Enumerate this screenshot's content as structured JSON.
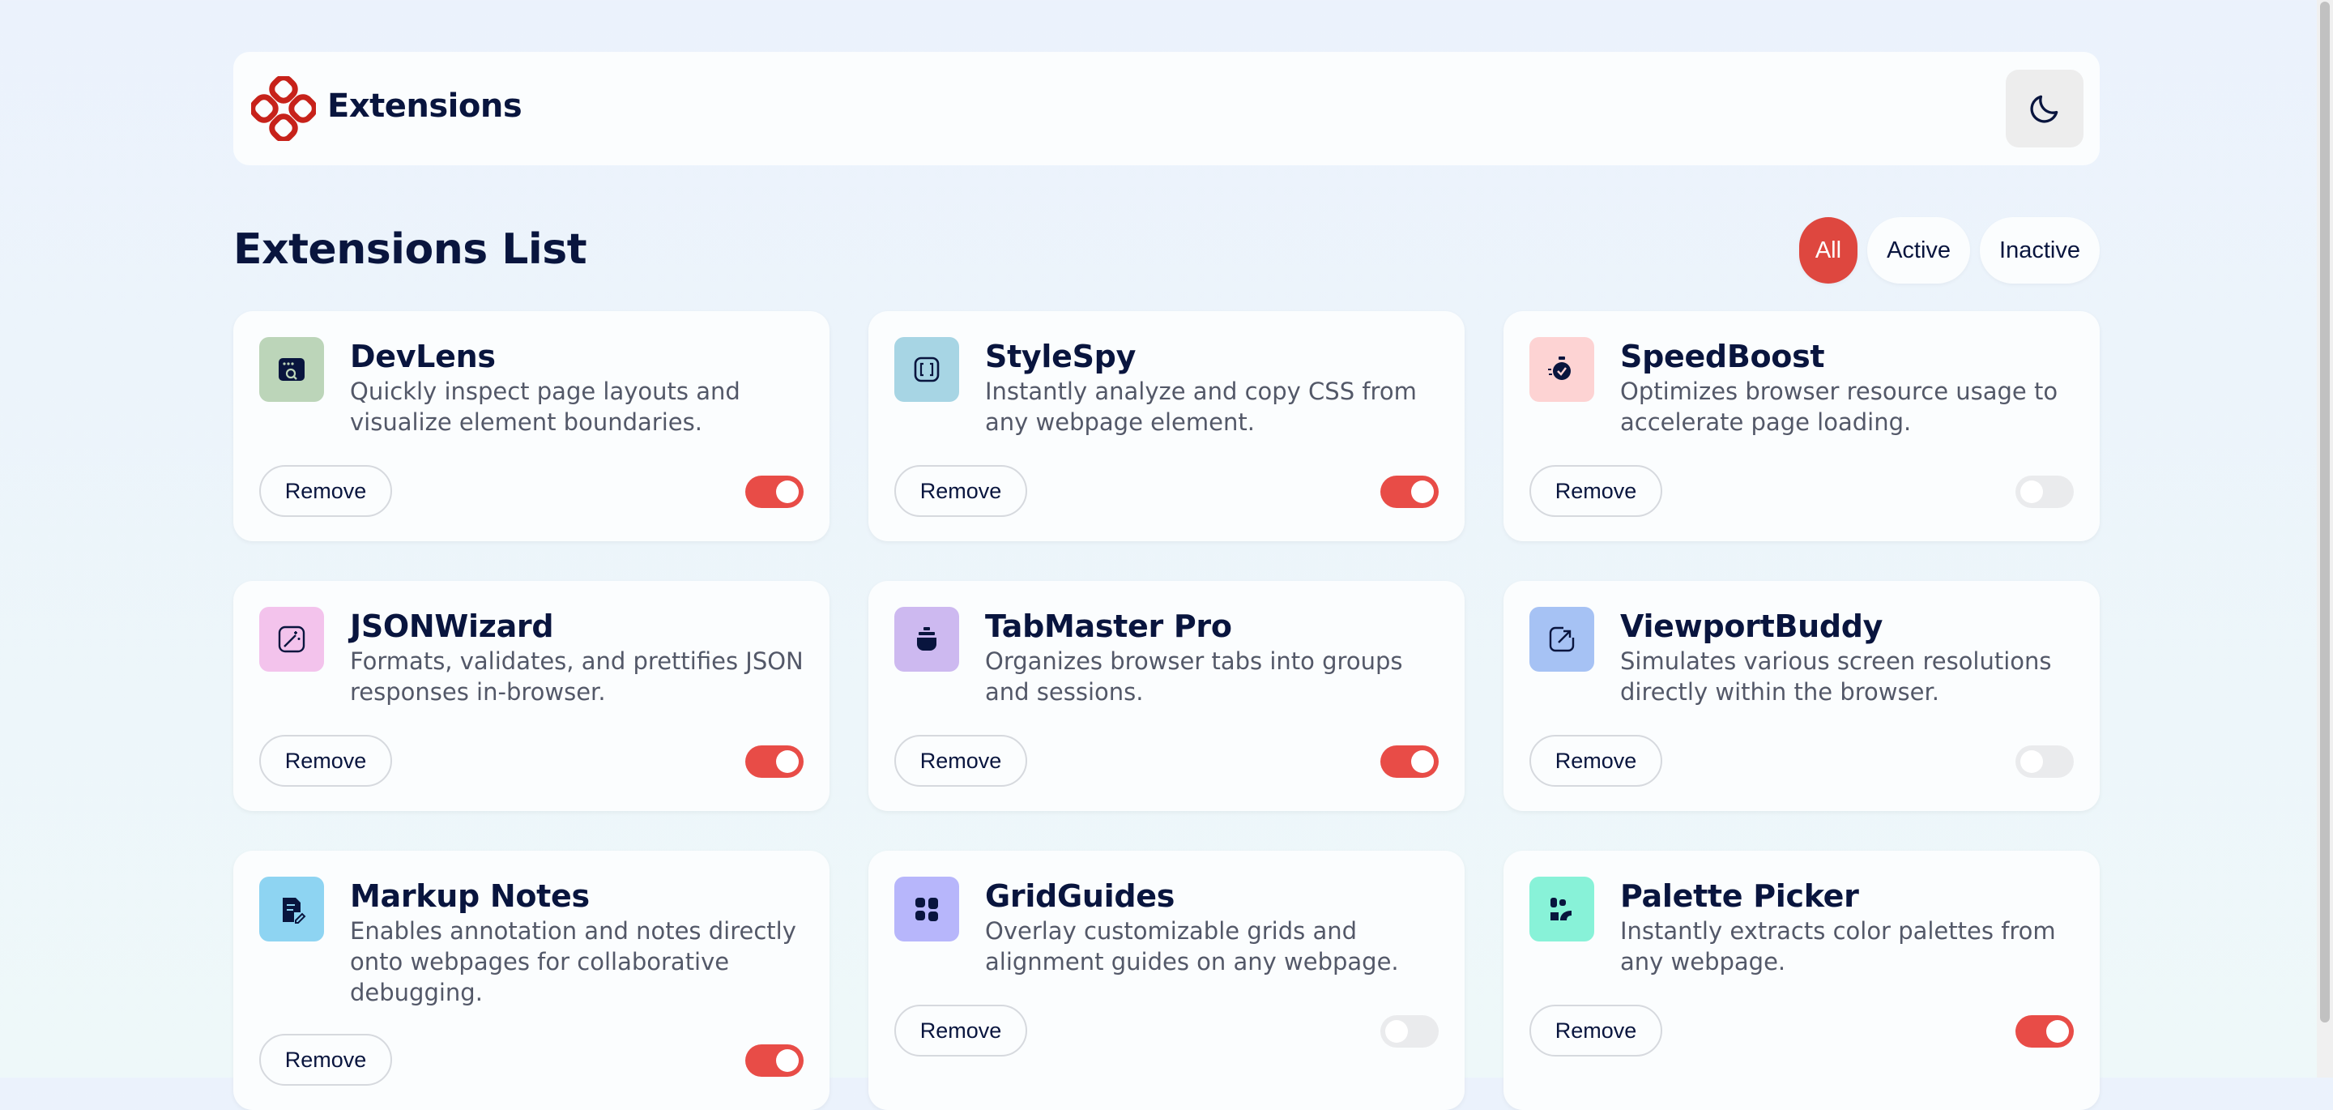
{
  "header": {
    "brand": "Extensions",
    "theme_toggle_icon": "moon-icon"
  },
  "main": {
    "title": "Extensions List",
    "filters": [
      {
        "label": "All",
        "active": true
      },
      {
        "label": "Active",
        "active": false
      },
      {
        "label": "Inactive",
        "active": false
      }
    ]
  },
  "extensions": [
    {
      "name": "DevLens",
      "description": "Quickly inspect page layouts and visualize element boundaries.",
      "remove_label": "Remove",
      "active": true,
      "icon": "devlens-icon",
      "icon_bg": "#bcd5b9"
    },
    {
      "name": "StyleSpy",
      "description": "Instantly analyze and copy CSS from any webpage element.",
      "remove_label": "Remove",
      "active": true,
      "icon": "stylespy-icon",
      "icon_bg": "#a7d5e4"
    },
    {
      "name": "SpeedBoost",
      "description": "Optimizes browser resource usage to accelerate page loading.",
      "remove_label": "Remove",
      "active": false,
      "icon": "speedboost-icon",
      "icon_bg": "#fdd3d3"
    },
    {
      "name": "JSONWizard",
      "description": "Formats, validates, and prettifies JSON responses in-browser.",
      "remove_label": "Remove",
      "active": true,
      "icon": "jsonwizard-icon",
      "icon_bg": "#f3c3ec"
    },
    {
      "name": "TabMaster Pro",
      "description": "Organizes browser tabs into groups and sessions.",
      "remove_label": "Remove",
      "active": true,
      "icon": "tabmaster-icon",
      "icon_bg": "#cdb9f0"
    },
    {
      "name": "ViewportBuddy",
      "description": "Simulates various screen resolutions directly within the browser.",
      "remove_label": "Remove",
      "active": false,
      "icon": "viewportbuddy-icon",
      "icon_bg": "#a6c2f4"
    },
    {
      "name": "Markup Notes",
      "description": "Enables annotation and notes directly onto webpages for collaborative debugging.",
      "remove_label": "Remove",
      "active": true,
      "icon": "markupnotes-icon",
      "icon_bg": "#8ed4f2"
    },
    {
      "name": "GridGuides",
      "description": "Overlay customizable grids and alignment guides on any webpage.",
      "remove_label": "Remove",
      "active": false,
      "icon": "gridguides-icon",
      "icon_bg": "#b7b6fb"
    },
    {
      "name": "Palette Picker",
      "description": "Instantly extracts color palettes from any webpage.",
      "remove_label": "Remove",
      "active": true,
      "icon": "palettepicker-icon",
      "icon_bg": "#88f2d8"
    }
  ],
  "colors": {
    "accent": "#de473f",
    "toggle_on": "#e84c47",
    "text_primary": "#09153e",
    "text_secondary": "#535868"
  }
}
